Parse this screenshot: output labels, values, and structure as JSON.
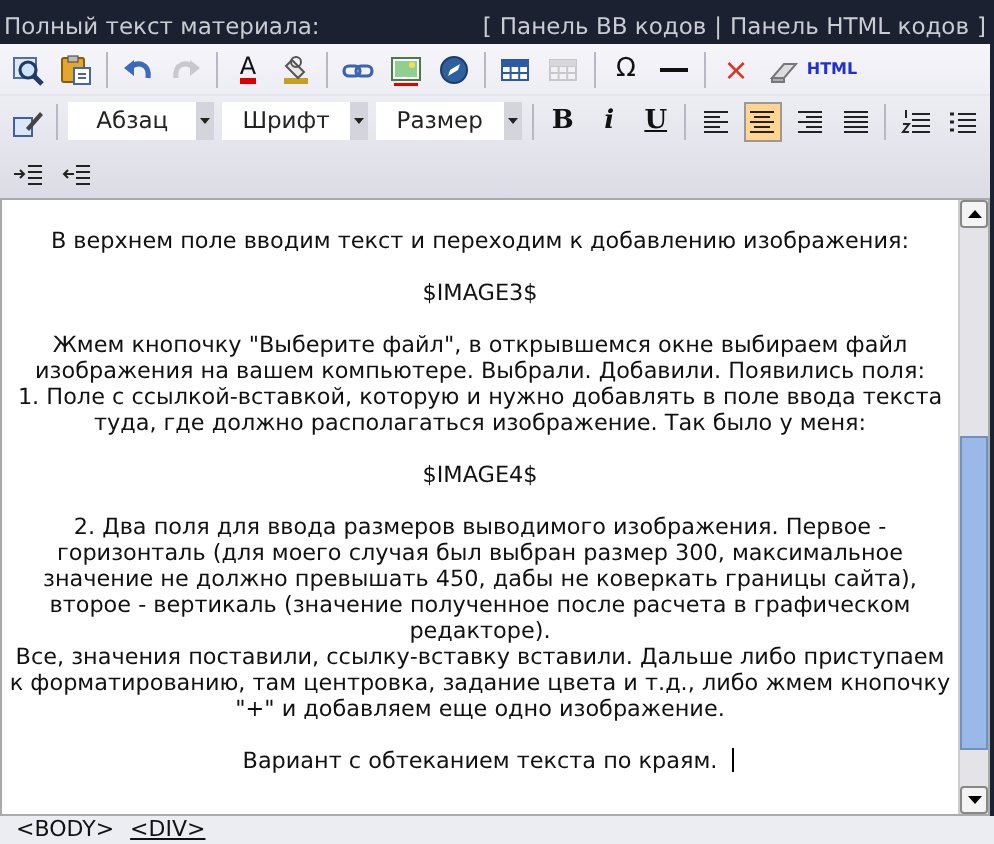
{
  "header": {
    "title": "Полный текст материала:",
    "links": [
      "Панель BB кодов",
      "Панель HTML кодов"
    ],
    "open_bracket": "[",
    "divider": "|",
    "close_bracket": "]"
  },
  "toolbar": [
    [
      [
        {
          "kind": "preview"
        },
        {
          "kind": "paste"
        }
      ],
      [
        {
          "kind": "undo"
        },
        {
          "kind": "redo",
          "disabled": true
        }
      ],
      [
        {
          "kind": "textcolor",
          "label": "A"
        },
        {
          "kind": "bgcolor"
        }
      ],
      [
        {
          "kind": "link"
        },
        {
          "kind": "image",
          "marked": true
        },
        {
          "kind": "flash"
        }
      ],
      [
        {
          "kind": "table"
        },
        {
          "kind": "tableprops",
          "disabled": true
        }
      ],
      [
        {
          "kind": "char",
          "label": "Ω"
        },
        {
          "kind": "rule"
        }
      ],
      [
        {
          "kind": "remove",
          "label": "×"
        },
        {
          "kind": "eraser"
        },
        {
          "kind": "html",
          "label": "HTML"
        }
      ]
    ],
    [
      [
        {
          "kind": "edit"
        }
      ],
      [
        {
          "kind": "select",
          "label": "Абзац"
        },
        {
          "kind": "select",
          "label": "Шрифт"
        },
        {
          "kind": "select",
          "label": "Размер"
        }
      ],
      [
        {
          "kind": "bold",
          "label": "B"
        },
        {
          "kind": "italic",
          "label": "i"
        },
        {
          "kind": "underline",
          "label": "U"
        }
      ],
      [
        {
          "kind": "alignleft",
          "selected": false
        },
        {
          "kind": "aligncenter",
          "selected": true
        },
        {
          "kind": "alignright",
          "selected": false
        },
        {
          "kind": "justify",
          "selected": false
        }
      ],
      [
        {
          "kind": "ol"
        },
        {
          "kind": "ul"
        }
      ]
    ],
    [
      [
        {
          "kind": "indent"
        },
        {
          "kind": "outdent"
        }
      ]
    ]
  ],
  "editor": {
    "paragraphs": [
      [
        "В верхнем поле вводим текст и переходим к добавлению изображения:"
      ],
      [
        "$IMAGE3$"
      ],
      [
        "Жмем кнопочку \"Выберите файл\", в открывшемся окне выбираем файл",
        "изображения на вашем компьютере. Выбрали. Добавили. Появились поля:",
        "1. Поле с ссылкой-вставкой, которую и нужно добавлять в поле ввода текста",
        "туда, где должно располагаться изображение. Так было у меня:"
      ],
      [
        "$IMAGE4$"
      ],
      [
        "2. Два поля для ввода размеров выводимого изображения. Первое -",
        "горизонталь (для моего случая был выбран размер 300, максимальное",
        "значение не должно превышать 450, дабы не коверкать границы сайта),",
        "второе - вертикаль (значение полученное после расчета в графическом",
        "редакторе).",
        "Все, значения поставили, ссылку-вставку вставили. Дальше либо приступаем",
        "к форматированию, там центровка, задание цвета и т.д., либо жмем кнопочку",
        "\"+\" и добавляем еще одно изображение."
      ],
      [
        "Вариант с обтеканием текста по краям."
      ]
    ]
  },
  "status_bar": [
    {
      "tag": "<BODY>",
      "selected": false
    },
    {
      "tag": "<DIV>",
      "selected": true
    }
  ]
}
